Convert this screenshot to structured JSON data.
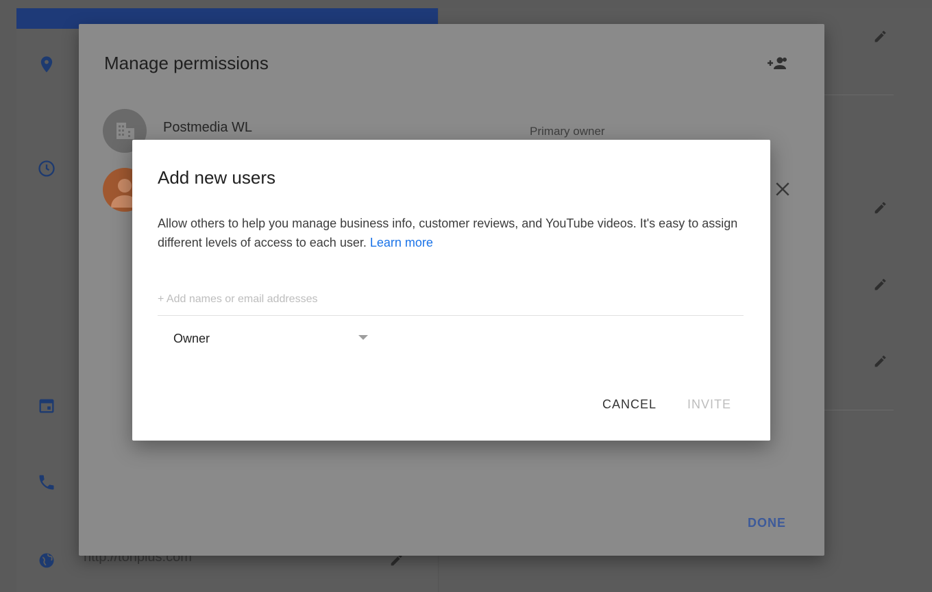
{
  "manage_permissions": {
    "title": "Manage permissions",
    "owner": {
      "name": "Postmedia WL",
      "role": "Primary owner"
    },
    "done_label": "DONE"
  },
  "background": {
    "website_url": "http://tonplus.com"
  },
  "add_users_dialog": {
    "title": "Add new users",
    "description": "Allow others to help you manage business info, customer reviews, and YouTube videos. It's easy to assign different levels of access to each user.",
    "learn_more": "Learn more",
    "input_placeholder": "+ Add names or email addresses",
    "role_selected": "Owner",
    "cancel_label": "CANCEL",
    "invite_label": "INVITE"
  },
  "colors": {
    "link": "#1a73e8",
    "disabled": "#bdbdbd",
    "done": "#3d5a9a"
  }
}
